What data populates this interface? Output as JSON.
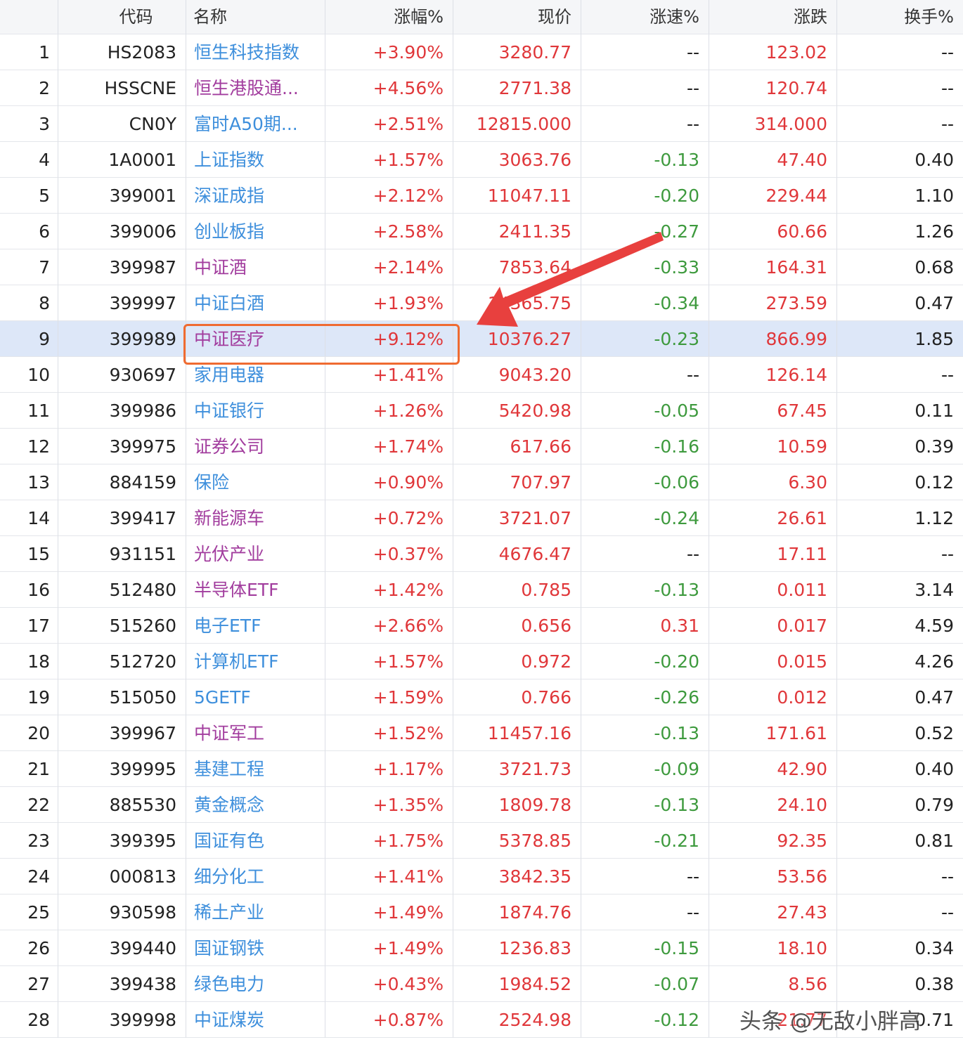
{
  "columns": [
    "",
    "代码",
    "名称",
    "涨幅%",
    "现价",
    "涨速%",
    "涨跌",
    "换手%"
  ],
  "colors": {
    "name_blue": "#3e8fdc",
    "name_purple": "#a23d9e",
    "up_red": "#e0373a",
    "down_green": "#3e9a3e",
    "highlight_row": "#dde7f8",
    "annotation_orange": "#ef6b31",
    "arrow_red": "#e8403e"
  },
  "highlighted_row_index": 8,
  "rows": [
    {
      "idx": "1",
      "code": "HS2083",
      "name": "恒生科技指数",
      "name_color": "blue",
      "pct": "+3.90%",
      "price": "3280.77",
      "speed": "--",
      "speed_color": "dark",
      "change": "123.02",
      "turnover": "--"
    },
    {
      "idx": "2",
      "code": "HSSCNE",
      "name": "恒生港股通...",
      "name_color": "purple",
      "pct": "+4.56%",
      "price": "2771.38",
      "speed": "--",
      "speed_color": "dark",
      "change": "120.74",
      "turnover": "--"
    },
    {
      "idx": "3",
      "code": "CN0Y",
      "name": "富时A50期...",
      "name_color": "blue",
      "pct": "+2.51%",
      "price": "12815.000",
      "speed": "--",
      "speed_color": "dark",
      "change": "314.000",
      "turnover": "--"
    },
    {
      "idx": "4",
      "code": "1A0001",
      "name": "上证指数",
      "name_color": "blue",
      "pct": "+1.57%",
      "price": "3063.76",
      "speed": "-0.13",
      "speed_color": "green",
      "change": "47.40",
      "turnover": "0.40"
    },
    {
      "idx": "5",
      "code": "399001",
      "name": "深证成指",
      "name_color": "blue",
      "pct": "+2.12%",
      "price": "11047.11",
      "speed": "-0.20",
      "speed_color": "green",
      "change": "229.44",
      "turnover": "1.10"
    },
    {
      "idx": "6",
      "code": "399006",
      "name": "创业板指",
      "name_color": "blue",
      "pct": "+2.58%",
      "price": "2411.35",
      "speed": "-0.27",
      "speed_color": "green",
      "change": "60.66",
      "turnover": "1.26"
    },
    {
      "idx": "7",
      "code": "399987",
      "name": "中证酒",
      "name_color": "purple",
      "pct": "+2.14%",
      "price": "7853.64",
      "speed": "-0.33",
      "speed_color": "green",
      "change": "164.31",
      "turnover": "0.68"
    },
    {
      "idx": "8",
      "code": "399997",
      "name": "中证白酒",
      "name_color": "blue",
      "pct": "+1.93%",
      "price": "14365.75",
      "speed": "-0.34",
      "speed_color": "green",
      "change": "273.59",
      "turnover": "0.47"
    },
    {
      "idx": "9",
      "code": "399989",
      "name": "中证医疗",
      "name_color": "purple",
      "pct": "+9.12%",
      "price": "10376.27",
      "speed": "-0.23",
      "speed_color": "green",
      "change": "866.99",
      "turnover": "1.85"
    },
    {
      "idx": "10",
      "code": "930697",
      "name": "家用电器",
      "name_color": "blue",
      "pct": "+1.41%",
      "price": "9043.20",
      "speed": "--",
      "speed_color": "dark",
      "change": "126.14",
      "turnover": "--"
    },
    {
      "idx": "11",
      "code": "399986",
      "name": "中证银行",
      "name_color": "blue",
      "pct": "+1.26%",
      "price": "5420.98",
      "speed": "-0.05",
      "speed_color": "green",
      "change": "67.45",
      "turnover": "0.11"
    },
    {
      "idx": "12",
      "code": "399975",
      "name": "证券公司",
      "name_color": "purple",
      "pct": "+1.74%",
      "price": "617.66",
      "speed": "-0.16",
      "speed_color": "green",
      "change": "10.59",
      "turnover": "0.39"
    },
    {
      "idx": "13",
      "code": "884159",
      "name": "保险",
      "name_color": "blue",
      "pct": "+0.90%",
      "price": "707.97",
      "speed": "-0.06",
      "speed_color": "green",
      "change": "6.30",
      "turnover": "0.12"
    },
    {
      "idx": "14",
      "code": "399417",
      "name": "新能源车",
      "name_color": "purple",
      "pct": "+0.72%",
      "price": "3721.07",
      "speed": "-0.24",
      "speed_color": "green",
      "change": "26.61",
      "turnover": "1.12"
    },
    {
      "idx": "15",
      "code": "931151",
      "name": "光伏产业",
      "name_color": "purple",
      "pct": "+0.37%",
      "price": "4676.47",
      "speed": "--",
      "speed_color": "dark",
      "change": "17.11",
      "turnover": "--"
    },
    {
      "idx": "16",
      "code": "512480",
      "name": "半导体ETF",
      "name_color": "purple",
      "pct": "+1.42%",
      "price": "0.785",
      "speed": "-0.13",
      "speed_color": "green",
      "change": "0.011",
      "turnover": "3.14"
    },
    {
      "idx": "17",
      "code": "515260",
      "name": "电子ETF",
      "name_color": "blue",
      "pct": "+2.66%",
      "price": "0.656",
      "speed": "0.31",
      "speed_color": "red",
      "change": "0.017",
      "turnover": "4.59"
    },
    {
      "idx": "18",
      "code": "512720",
      "name": "计算机ETF",
      "name_color": "blue",
      "pct": "+1.57%",
      "price": "0.972",
      "speed": "-0.20",
      "speed_color": "green",
      "change": "0.015",
      "turnover": "4.26"
    },
    {
      "idx": "19",
      "code": "515050",
      "name": "5GETF",
      "name_color": "blue",
      "pct": "+1.59%",
      "price": "0.766",
      "speed": "-0.26",
      "speed_color": "green",
      "change": "0.012",
      "turnover": "0.47"
    },
    {
      "idx": "20",
      "code": "399967",
      "name": "中证军工",
      "name_color": "purple",
      "pct": "+1.52%",
      "price": "11457.16",
      "speed": "-0.13",
      "speed_color": "green",
      "change": "171.61",
      "turnover": "0.52"
    },
    {
      "idx": "21",
      "code": "399995",
      "name": "基建工程",
      "name_color": "blue",
      "pct": "+1.17%",
      "price": "3721.73",
      "speed": "-0.09",
      "speed_color": "green",
      "change": "42.90",
      "turnover": "0.40"
    },
    {
      "idx": "22",
      "code": "885530",
      "name": "黄金概念",
      "name_color": "blue",
      "pct": "+1.35%",
      "price": "1809.78",
      "speed": "-0.13",
      "speed_color": "green",
      "change": "24.10",
      "turnover": "0.79"
    },
    {
      "idx": "23",
      "code": "399395",
      "name": "国证有色",
      "name_color": "blue",
      "pct": "+1.75%",
      "price": "5378.85",
      "speed": "-0.21",
      "speed_color": "green",
      "change": "92.35",
      "turnover": "0.81"
    },
    {
      "idx": "24",
      "code": "000813",
      "name": "细分化工",
      "name_color": "blue",
      "pct": "+1.41%",
      "price": "3842.35",
      "speed": "--",
      "speed_color": "dark",
      "change": "53.56",
      "turnover": "--"
    },
    {
      "idx": "25",
      "code": "930598",
      "name": "稀土产业",
      "name_color": "blue",
      "pct": "+1.49%",
      "price": "1874.76",
      "speed": "--",
      "speed_color": "dark",
      "change": "27.43",
      "turnover": "--"
    },
    {
      "idx": "26",
      "code": "399440",
      "name": "国证钢铁",
      "name_color": "blue",
      "pct": "+1.49%",
      "price": "1236.83",
      "speed": "-0.15",
      "speed_color": "green",
      "change": "18.10",
      "turnover": "0.34"
    },
    {
      "idx": "27",
      "code": "399438",
      "name": "绿色电力",
      "name_color": "blue",
      "pct": "+0.43%",
      "price": "1984.52",
      "speed": "-0.07",
      "speed_color": "green",
      "change": "8.56",
      "turnover": "0.38"
    },
    {
      "idx": "28",
      "code": "399998",
      "name": "中证煤炭",
      "name_color": "blue",
      "pct": "+0.87%",
      "price": "2524.98",
      "speed": "-0.12",
      "speed_color": "green",
      "change": "21.77",
      "turnover": "0.71"
    }
  ],
  "watermark": "头条 @无敌小胖高"
}
